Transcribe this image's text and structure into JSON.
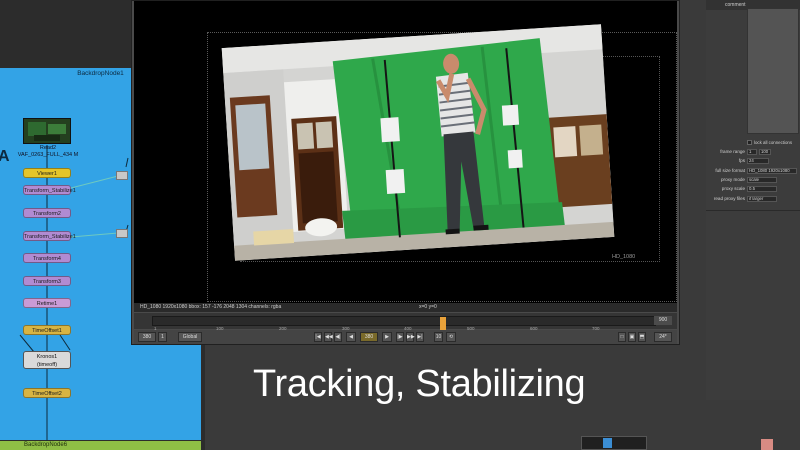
{
  "node_graph": {
    "backdrop_top": {
      "title": "BackdropNode1",
      "letter": "A",
      "color": "#33a3e6"
    },
    "backdrop_bottom": {
      "title": "BackdropNode6",
      "color": "#8fbe45"
    },
    "read_node": {
      "name": "Read2",
      "file": "VAF_0263_FULL_434 M"
    },
    "nodes": [
      {
        "label": "Viewer1"
      },
      {
        "label": "Transform_Stabilize1"
      },
      {
        "label": "Transform2"
      },
      {
        "label": "Transform_Stabilize1"
      },
      {
        "label": "Transform4"
      },
      {
        "label": "Transform3"
      },
      {
        "label": "Retime1"
      },
      {
        "label": "TimeOffset1"
      },
      {
        "label": "TimeOffset2"
      }
    ],
    "kronos": {
      "label": "Kronos1",
      "sublabel": "(timeoff)"
    }
  },
  "viewer": {
    "format_label": "HD_1080",
    "status_info": "HD_1080 1920x1080  bbox: 157 -176 2048 1304 channels: rgba",
    "status_center": "x=0 y=0",
    "timeline": {
      "ticks": [
        "1",
        "100",
        "200",
        "300",
        "400",
        "500",
        "600",
        "700",
        "800"
      ],
      "frame_label": "900",
      "current_frame": "380"
    },
    "controls": {
      "frame_value": "380",
      "zoom": "1",
      "mode": "Global",
      "increment": "10",
      "fps": "24*"
    }
  },
  "overlay_text": "Tracking, Stabilizing",
  "properties": {
    "comment_label": "comment",
    "lock_label": "lock all connections",
    "rows": [
      {
        "label": "frame range",
        "value": "1",
        "value2": "100"
      },
      {
        "label": "fps",
        "value": "24"
      },
      {
        "label": "full size format",
        "value": "HD_1080 1920x1080"
      },
      {
        "label": "proxy mode",
        "value": "scale"
      },
      {
        "label": "proxy scale",
        "value": "0.5"
      },
      {
        "label": "read proxy files",
        "value": "if larger"
      }
    ]
  },
  "colors": {
    "viewer_bg": "#000000",
    "greenscreen": "#2fa84b",
    "timeline_marker": "#e8a13a"
  }
}
